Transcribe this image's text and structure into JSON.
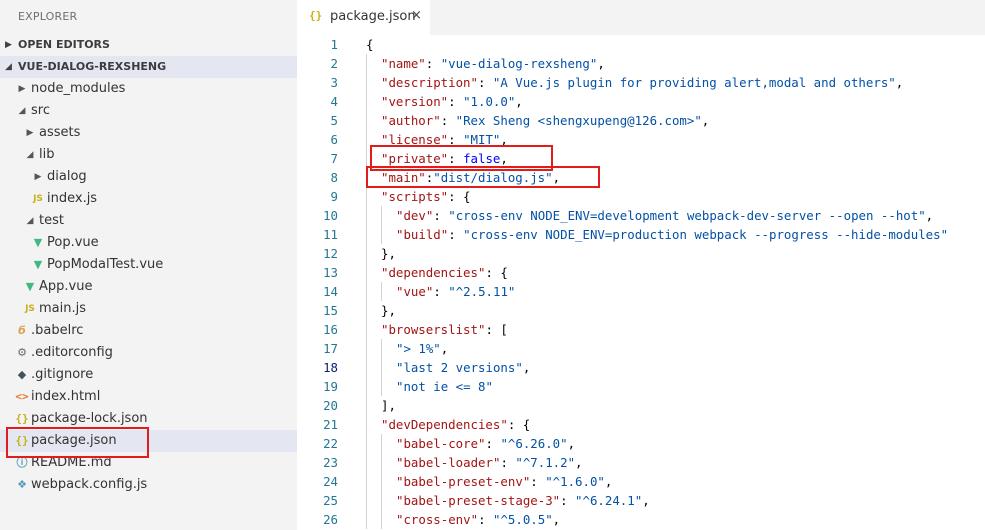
{
  "sidebar": {
    "title": "EXPLORER",
    "open_editors": "OPEN EDITORS",
    "project": "VUE-DIALOG-REXSHENG",
    "tree": [
      {
        "label": "node_modules",
        "type": "folder",
        "depth": 1,
        "expanded": false
      },
      {
        "label": "src",
        "type": "folder",
        "depth": 1,
        "expanded": true
      },
      {
        "label": "assets",
        "type": "folder",
        "depth": 2,
        "expanded": false
      },
      {
        "label": "lib",
        "type": "folder",
        "depth": 2,
        "expanded": true
      },
      {
        "label": "dialog",
        "type": "folder",
        "depth": 3,
        "expanded": false
      },
      {
        "label": "index.js",
        "type": "js",
        "depth": 3
      },
      {
        "label": "test",
        "type": "folder",
        "depth": 2,
        "expanded": true
      },
      {
        "label": "Pop.vue",
        "type": "vue",
        "depth": 3
      },
      {
        "label": "PopModalTest.vue",
        "type": "vue",
        "depth": 3
      },
      {
        "label": "App.vue",
        "type": "vue",
        "depth": 2
      },
      {
        "label": "main.js",
        "type": "js",
        "depth": 2
      },
      {
        "label": ".babelrc",
        "type": "babel",
        "depth": 1
      },
      {
        "label": ".editorconfig",
        "type": "gear",
        "depth": 1
      },
      {
        "label": ".gitignore",
        "type": "git",
        "depth": 1
      },
      {
        "label": "index.html",
        "type": "html",
        "depth": 1
      },
      {
        "label": "package-lock.json",
        "type": "json",
        "depth": 1
      },
      {
        "label": "package.json",
        "type": "json",
        "depth": 1,
        "selected": true
      },
      {
        "label": "README.md",
        "type": "info",
        "depth": 1
      },
      {
        "label": "webpack.config.js",
        "type": "webpack",
        "depth": 1
      }
    ]
  },
  "icons": {
    "js": "JS",
    "json": "{}",
    "vue": "▼",
    "babel": "б",
    "gear": "⚙",
    "git": "◆",
    "html": "<>",
    "info": "ⓘ",
    "webpack": "❖",
    "chevron_right": "▶",
    "chevron_down": "◢",
    "close": "×"
  },
  "editor": {
    "tab_label": "package.json",
    "current_line": 18,
    "lines": [
      {
        "n": 1,
        "indent": 0,
        "tokens": [
          [
            "p",
            "{"
          ]
        ]
      },
      {
        "n": 2,
        "indent": 1,
        "tokens": [
          [
            "k",
            "\"name\""
          ],
          [
            "p",
            ": "
          ],
          [
            "s",
            "\"vue-dialog-rexsheng\""
          ],
          [
            "p",
            ","
          ]
        ]
      },
      {
        "n": 3,
        "indent": 1,
        "tokens": [
          [
            "k",
            "\"description\""
          ],
          [
            "p",
            ": "
          ],
          [
            "s",
            "\"A Vue.js plugin for providing alert,modal and others\""
          ],
          [
            "p",
            ","
          ]
        ]
      },
      {
        "n": 4,
        "indent": 1,
        "tokens": [
          [
            "k",
            "\"version\""
          ],
          [
            "p",
            ": "
          ],
          [
            "s",
            "\"1.0.0\""
          ],
          [
            "p",
            ","
          ]
        ]
      },
      {
        "n": 5,
        "indent": 1,
        "tokens": [
          [
            "k",
            "\"author\""
          ],
          [
            "p",
            ": "
          ],
          [
            "s",
            "\"Rex Sheng <shengxupeng@126.com>\""
          ],
          [
            "p",
            ","
          ]
        ]
      },
      {
        "n": 6,
        "indent": 1,
        "tokens": [
          [
            "k",
            "\"license\""
          ],
          [
            "p",
            ": "
          ],
          [
            "s",
            "\"MIT\""
          ],
          [
            "p",
            ","
          ]
        ]
      },
      {
        "n": 7,
        "indent": 1,
        "tokens": [
          [
            "k",
            "\"private\""
          ],
          [
            "p",
            ": "
          ],
          [
            "b",
            "false"
          ],
          [
            "p",
            ","
          ]
        ]
      },
      {
        "n": 8,
        "indent": 1,
        "tokens": [
          [
            "k",
            "\"main\""
          ],
          [
            "p",
            ":"
          ],
          [
            "s",
            "\"dist/dialog.js\""
          ],
          [
            "p",
            ","
          ]
        ]
      },
      {
        "n": 9,
        "indent": 1,
        "tokens": [
          [
            "k",
            "\"scripts\""
          ],
          [
            "p",
            ": {"
          ]
        ]
      },
      {
        "n": 10,
        "indent": 2,
        "tokens": [
          [
            "k",
            "\"dev\""
          ],
          [
            "p",
            ": "
          ],
          [
            "s",
            "\"cross-env NODE_ENV=development webpack-dev-server --open --hot\""
          ],
          [
            "p",
            ","
          ]
        ]
      },
      {
        "n": 11,
        "indent": 2,
        "tokens": [
          [
            "k",
            "\"build\""
          ],
          [
            "p",
            ": "
          ],
          [
            "s",
            "\"cross-env NODE_ENV=production webpack --progress --hide-modules\""
          ]
        ]
      },
      {
        "n": 12,
        "indent": 1,
        "tokens": [
          [
            "p",
            "},"
          ]
        ]
      },
      {
        "n": 13,
        "indent": 1,
        "tokens": [
          [
            "k",
            "\"dependencies\""
          ],
          [
            "p",
            ": {"
          ]
        ]
      },
      {
        "n": 14,
        "indent": 2,
        "tokens": [
          [
            "k",
            "\"vue\""
          ],
          [
            "p",
            ": "
          ],
          [
            "s",
            "\"^2.5.11\""
          ]
        ]
      },
      {
        "n": 15,
        "indent": 1,
        "tokens": [
          [
            "p",
            "},"
          ]
        ]
      },
      {
        "n": 16,
        "indent": 1,
        "tokens": [
          [
            "k",
            "\"browserslist\""
          ],
          [
            "p",
            ": ["
          ]
        ]
      },
      {
        "n": 17,
        "indent": 2,
        "tokens": [
          [
            "s",
            "\"> 1%\""
          ],
          [
            "p",
            ","
          ]
        ]
      },
      {
        "n": 18,
        "indent": 2,
        "tokens": [
          [
            "s",
            "\"last 2 versions\""
          ],
          [
            "p",
            ","
          ]
        ]
      },
      {
        "n": 19,
        "indent": 2,
        "tokens": [
          [
            "s",
            "\"not ie <= 8\""
          ]
        ]
      },
      {
        "n": 20,
        "indent": 1,
        "tokens": [
          [
            "p",
            "],"
          ]
        ]
      },
      {
        "n": 21,
        "indent": 1,
        "tokens": [
          [
            "k",
            "\"devDependencies\""
          ],
          [
            "p",
            ": {"
          ]
        ]
      },
      {
        "n": 22,
        "indent": 2,
        "tokens": [
          [
            "k",
            "\"babel-core\""
          ],
          [
            "p",
            ": "
          ],
          [
            "s",
            "\"^6.26.0\""
          ],
          [
            "p",
            ","
          ]
        ]
      },
      {
        "n": 23,
        "indent": 2,
        "tokens": [
          [
            "k",
            "\"babel-loader\""
          ],
          [
            "p",
            ": "
          ],
          [
            "s",
            "\"^7.1.2\""
          ],
          [
            "p",
            ","
          ]
        ]
      },
      {
        "n": 24,
        "indent": 2,
        "tokens": [
          [
            "k",
            "\"babel-preset-env\""
          ],
          [
            "p",
            ": "
          ],
          [
            "s",
            "\"^1.6.0\""
          ],
          [
            "p",
            ","
          ]
        ]
      },
      {
        "n": 25,
        "indent": 2,
        "tokens": [
          [
            "k",
            "\"babel-preset-stage-3\""
          ],
          [
            "p",
            ": "
          ],
          [
            "s",
            "\"^6.24.1\""
          ],
          [
            "p",
            ","
          ]
        ]
      },
      {
        "n": 26,
        "indent": 2,
        "tokens": [
          [
            "k",
            "\"cross-env\""
          ],
          [
            "p",
            ": "
          ],
          [
            "s",
            "\"^5.0.5\""
          ],
          [
            "p",
            ","
          ]
        ]
      }
    ]
  },
  "colors": {
    "highlight_box": "#e21b1b",
    "sidebar_bg": "#f3f3f3",
    "selected_bg": "#e4e6f1"
  }
}
